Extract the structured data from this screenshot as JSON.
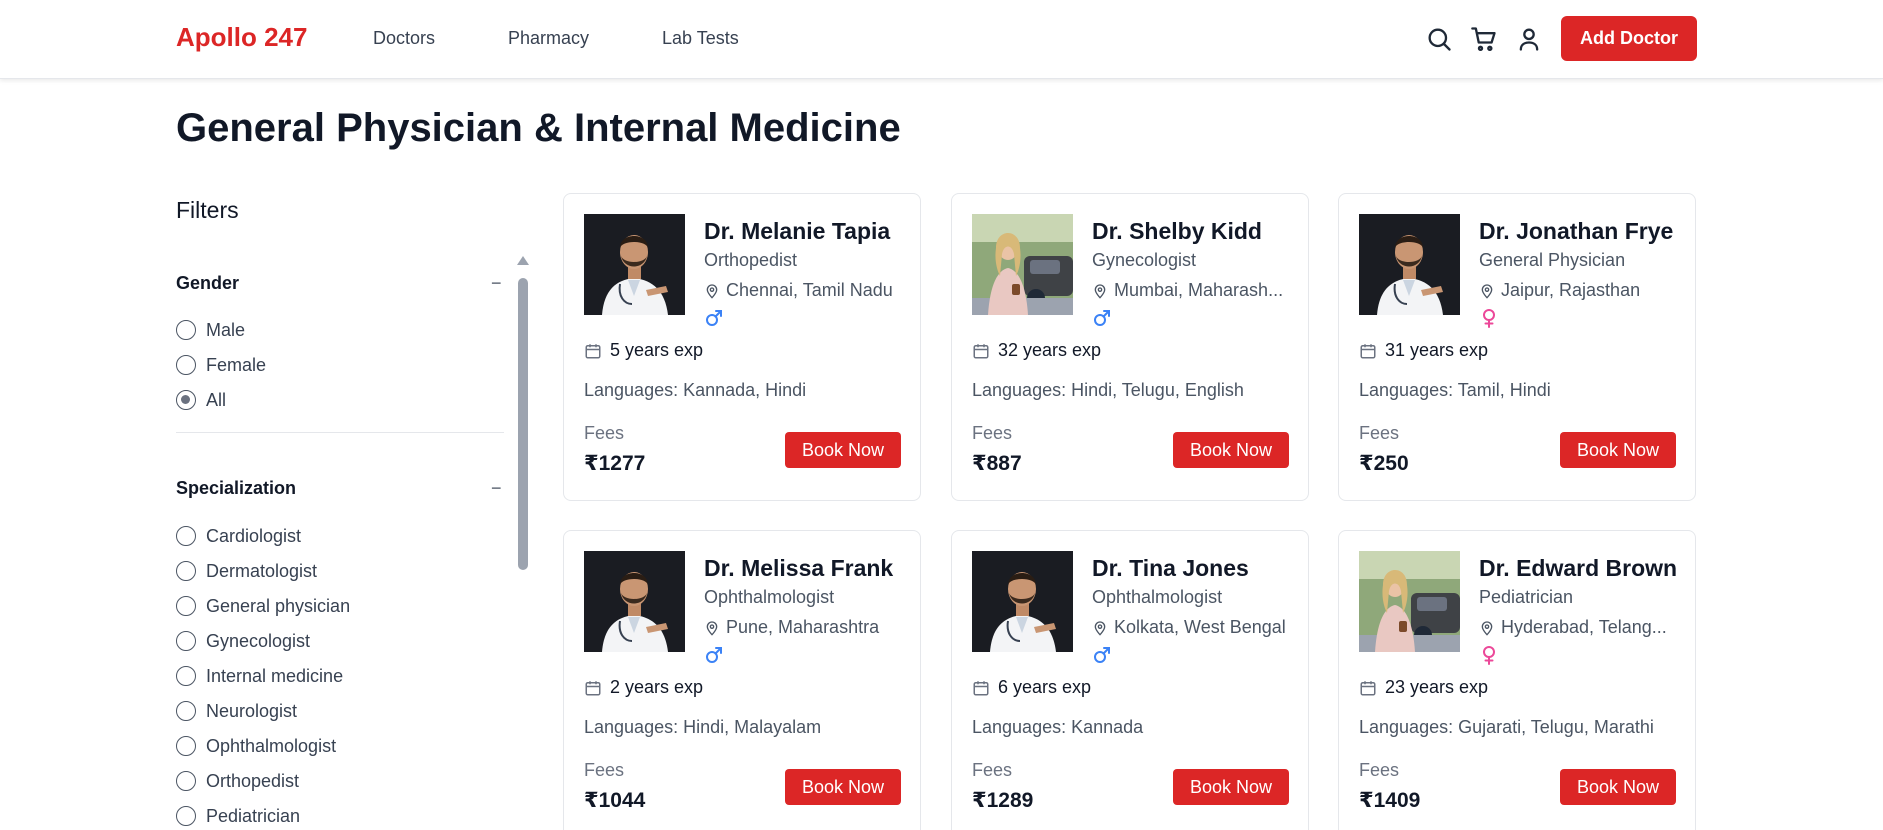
{
  "header": {
    "logo": "Apollo 247",
    "nav": [
      "Doctors",
      "Pharmacy",
      "Lab Tests"
    ],
    "add_doctor_label": "Add Doctor",
    "icons": [
      "search-icon",
      "cart-icon",
      "user-icon"
    ]
  },
  "page_title": "General Physician & Internal Medicine",
  "filters": {
    "title": "Filters",
    "gender": {
      "title": "Gender",
      "collapse": "−",
      "options": [
        "Male",
        "Female",
        "All"
      ],
      "selected": "All"
    },
    "specialization": {
      "title": "Specialization",
      "collapse": "−",
      "options": [
        "Cardiologist",
        "Dermatologist",
        "General physician",
        "Gynecologist",
        "Internal medicine",
        "Neurologist",
        "Ophthalmologist",
        "Orthopedist",
        "Pediatrician"
      ]
    }
  },
  "colors": {
    "brand": "#dc2626",
    "male": "#3b82f6",
    "female": "#ec4899"
  },
  "doctors": [
    {
      "name": "Dr. Melanie Tapia",
      "specialty": "Orthopedist",
      "location": "Chennai, Tamil Nadu",
      "gender": "male",
      "photo": "male-doctor",
      "experience": "5 years exp",
      "languages": "Languages: Kannada, Hindi",
      "fees_label": "Fees",
      "fees": "₹1277",
      "book_label": "Book Now"
    },
    {
      "name": "Dr. Shelby Kidd",
      "specialty": "Gynecologist",
      "location": "Mumbai, Maharash...",
      "gender": "male",
      "photo": "female-doctor",
      "experience": "32 years exp",
      "languages": "Languages: Hindi, Telugu, English",
      "fees_label": "Fees",
      "fees": "₹887",
      "book_label": "Book Now"
    },
    {
      "name": "Dr. Jonathan Frye",
      "specialty": "General Physician",
      "location": "Jaipur, Rajasthan",
      "gender": "female",
      "photo": "male-doctor",
      "experience": "31 years exp",
      "languages": "Languages: Tamil, Hindi",
      "fees_label": "Fees",
      "fees": "₹250",
      "book_label": "Book Now"
    },
    {
      "name": "Dr. Melissa Frank",
      "specialty": "Ophthalmologist",
      "location": "Pune, Maharashtra",
      "gender": "male",
      "photo": "male-doctor",
      "experience": "2 years exp",
      "languages": "Languages: Hindi, Malayalam",
      "fees_label": "Fees",
      "fees": "₹1044",
      "book_label": "Book Now"
    },
    {
      "name": "Dr. Tina Jones",
      "specialty": "Ophthalmologist",
      "location": "Kolkata, West Bengal",
      "gender": "male",
      "photo": "male-doctor",
      "experience": "6 years exp",
      "languages": "Languages: Kannada",
      "fees_label": "Fees",
      "fees": "₹1289",
      "book_label": "Book Now"
    },
    {
      "name": "Dr. Edward Brown",
      "specialty": "Pediatrician",
      "location": "Hyderabad, Telang...",
      "gender": "female",
      "photo": "female-doctor",
      "experience": "23 years exp",
      "languages": "Languages: Gujarati, Telugu, Marathi",
      "fees_label": "Fees",
      "fees": "₹1409",
      "book_label": "Book Now"
    }
  ]
}
